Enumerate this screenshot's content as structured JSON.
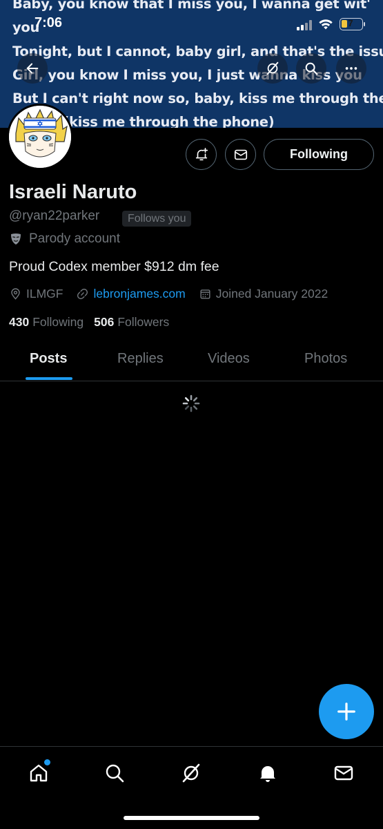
{
  "status_bar": {
    "time": "7:06",
    "battery": "7"
  },
  "banner": {
    "lyrics": [
      "Baby, you know that I miss you, I wanna get wit'",
      "you",
      "Tonight, but I cannot, baby girl, and that's the issue",
      "Girl, you know I miss you, I just wanna kiss you",
      "But I can't right now so, baby, kiss me through the",
      "phone (kiss me through the phone)"
    ],
    "icons": [
      "back-arrow-icon",
      "grok-icon",
      "search-icon",
      "more-icon"
    ]
  },
  "profile": {
    "name": "Israeli Naruto",
    "handle": "@ryan22parker",
    "follows_you": "Follows you",
    "parody": "Parody account",
    "bio": "Proud Codex member $912 dm fee",
    "location": "ILMGF",
    "website": "lebronjames.com",
    "joined": "Joined January 2022",
    "following_count": "430",
    "following_label": "Following",
    "followers_count": "506",
    "followers_label": "Followers"
  },
  "actions": {
    "following_button": "Following"
  },
  "tabs": [
    {
      "label": "Posts",
      "active": true
    },
    {
      "label": "Replies",
      "active": false
    },
    {
      "label": "Videos",
      "active": false
    },
    {
      "label": "Photos",
      "active": false
    }
  ],
  "bottom_nav": [
    "home-icon",
    "search-icon",
    "grok-icon",
    "notifications-icon",
    "messages-icon"
  ],
  "colors": {
    "accent": "#1d9bf0",
    "banner": "#0f3566",
    "muted": "#71767b"
  }
}
